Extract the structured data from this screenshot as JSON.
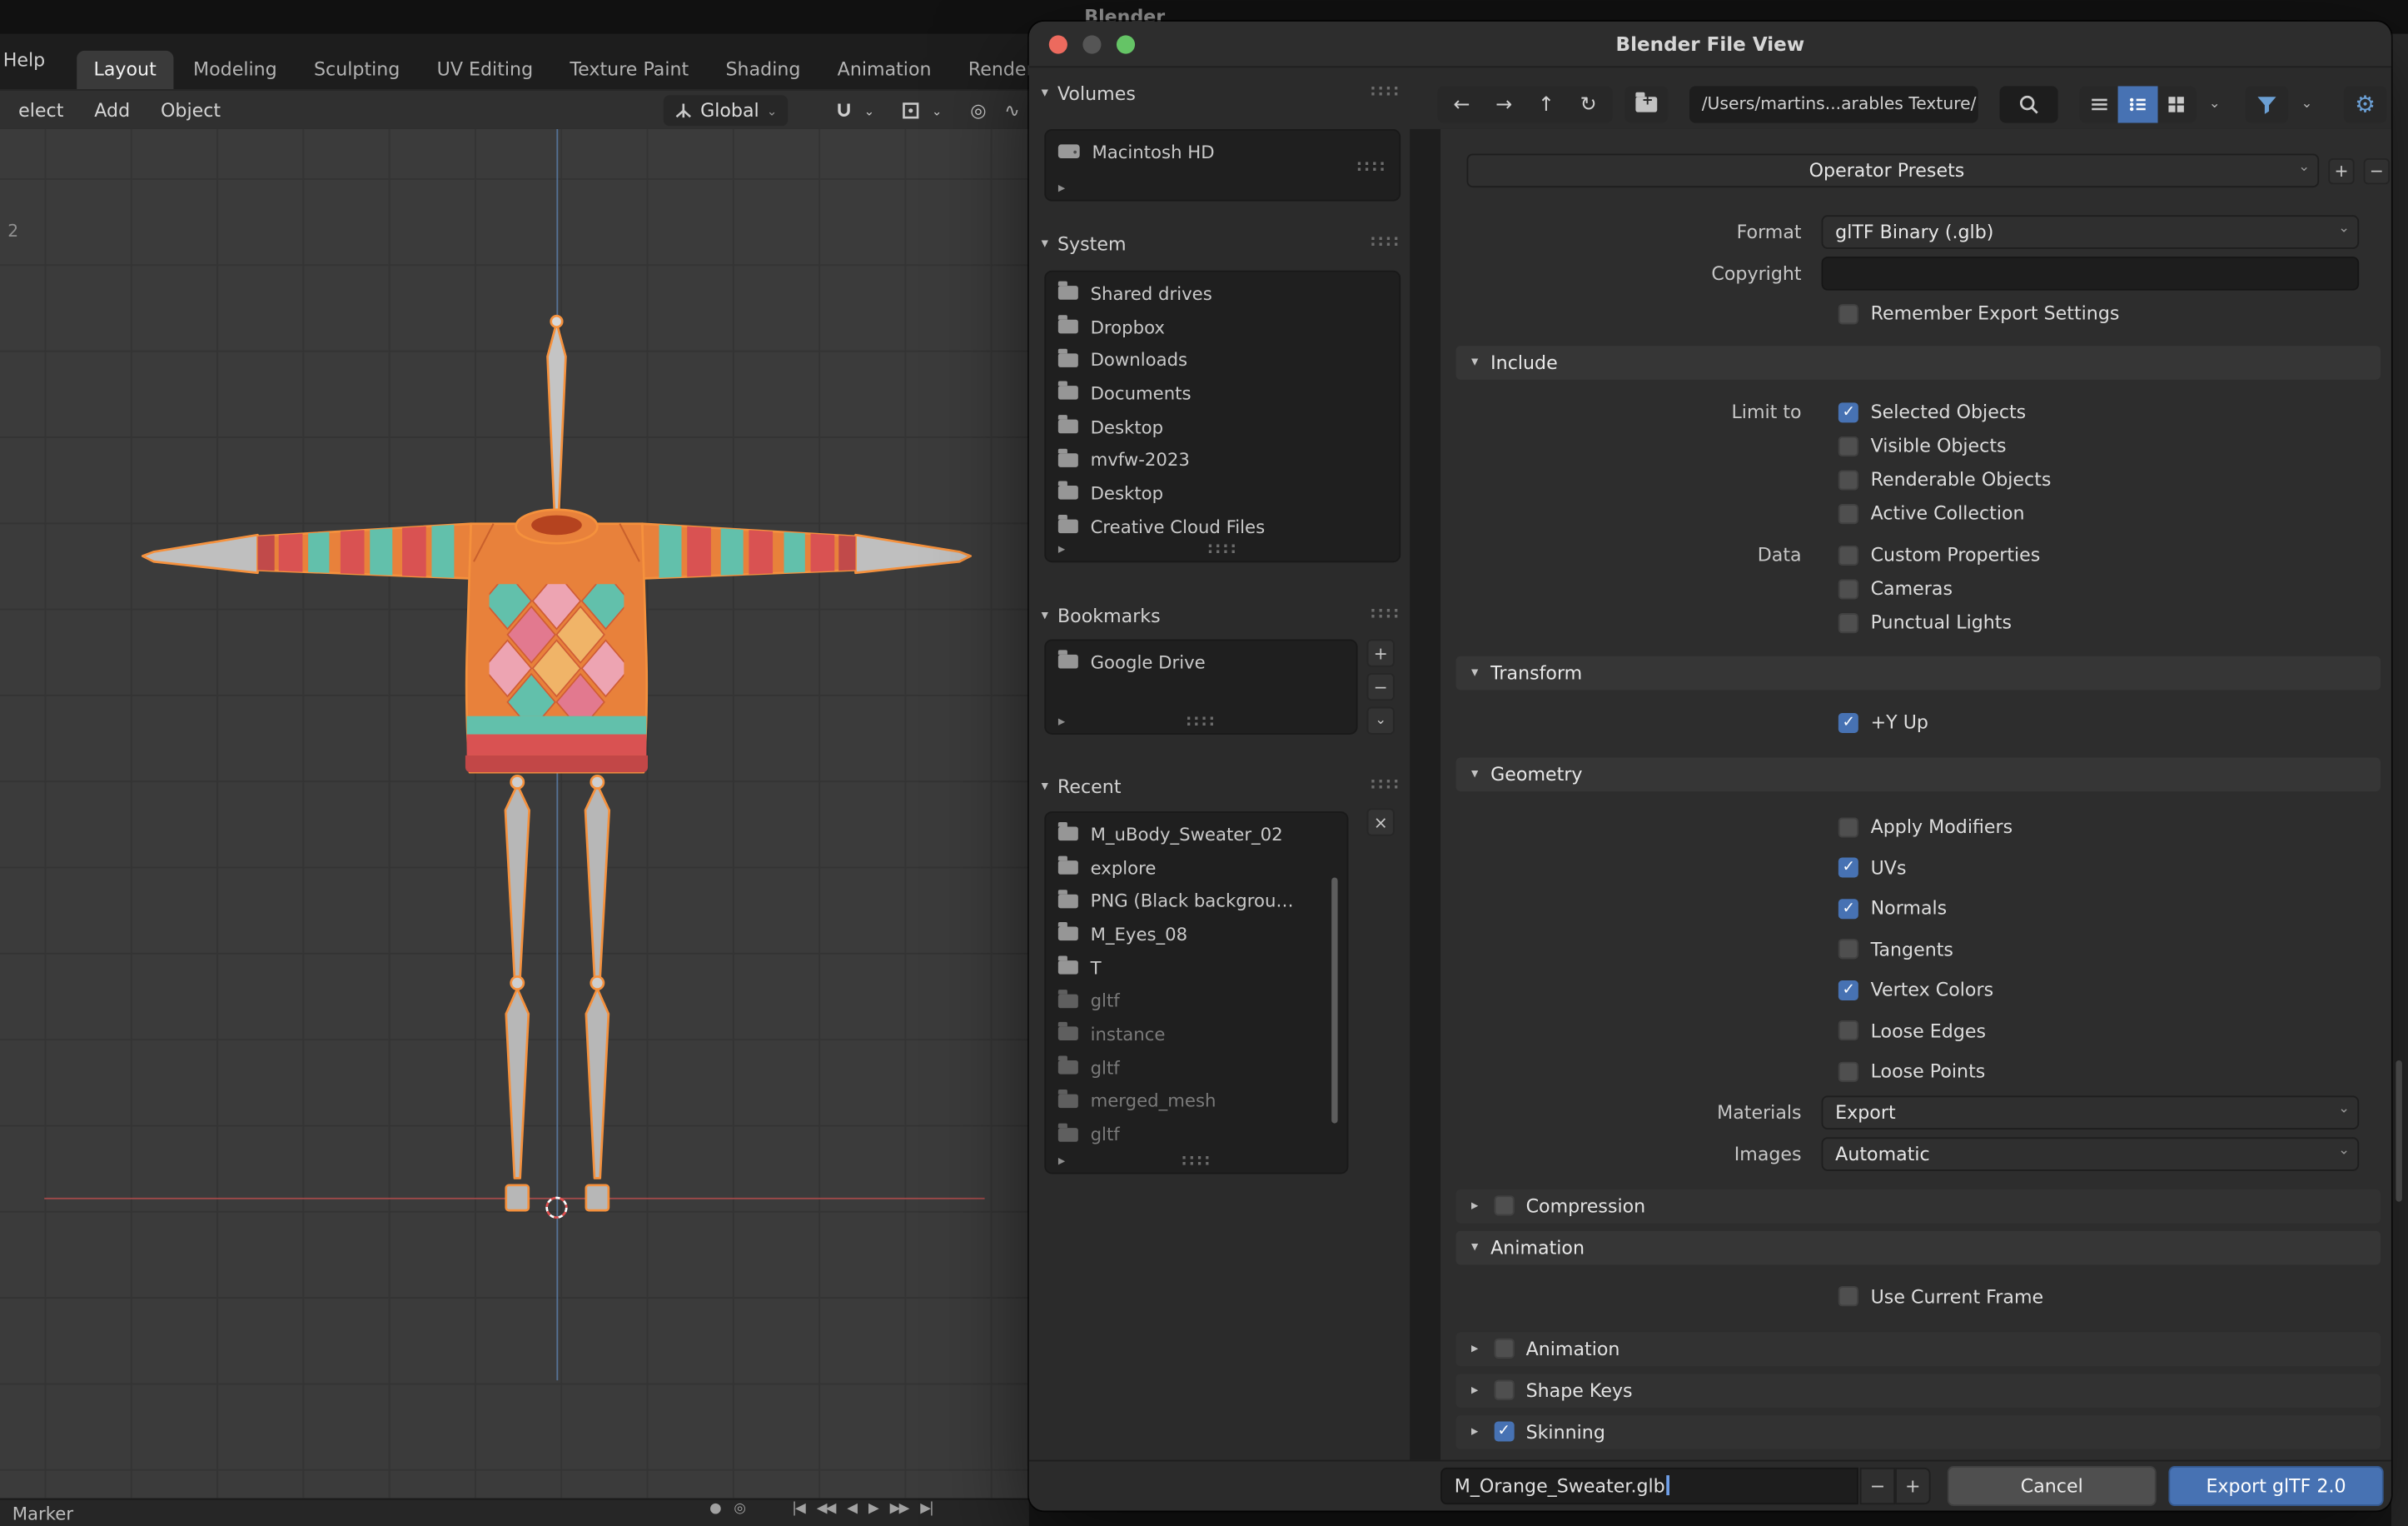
{
  "icons": {
    "chevron_down": "▾",
    "chevron_right": "▸",
    "chevron_small": "⌄",
    "back": "←",
    "forward": "→",
    "up": "↑",
    "refresh": "↻",
    "plus": "+",
    "minus": "−",
    "close": "×",
    "grip": "::::",
    "gear": "⚙",
    "wave": "∿",
    "prop_circle": "◎"
  },
  "background": {
    "screen_title": "Blender",
    "help": "Help",
    "tabs": [
      {
        "label": "Layout",
        "state": "active"
      },
      {
        "label": "Modeling"
      },
      {
        "label": "Sculpting"
      },
      {
        "label": "UV Editing"
      },
      {
        "label": "Texture Paint"
      },
      {
        "label": "Shading"
      },
      {
        "label": "Animation"
      },
      {
        "label": "Rendering"
      }
    ],
    "viewport_menus": [
      "elect",
      "Add",
      "Object"
    ],
    "orientation": "Global",
    "frame_number": "2",
    "marker": "Marker",
    "playback": {
      "record": "●",
      "sphere": "◎",
      "buttons": [
        "|◀",
        "◀◀",
        "◀",
        "▶",
        "▶▶",
        "▶|"
      ]
    }
  },
  "dialog": {
    "title": "Blender File View",
    "toolbar": {
      "path": "/Users/martins...arables Texture/"
    },
    "sidebar": {
      "volumes": {
        "title": "Volumes",
        "items": [
          {
            "label": "Macintosh HD"
          }
        ]
      },
      "system": {
        "title": "System",
        "items": [
          {
            "label": "Shared drives"
          },
          {
            "label": "Dropbox"
          },
          {
            "label": "Downloads"
          },
          {
            "label": "Documents"
          },
          {
            "label": "Desktop"
          },
          {
            "label": "mvfw-2023"
          },
          {
            "label": "Desktop"
          },
          {
            "label": "Creative Cloud Files"
          }
        ]
      },
      "bookmarks": {
        "title": "Bookmarks",
        "items": [
          {
            "label": "Google Drive"
          }
        ]
      },
      "recent": {
        "title": "Recent",
        "items": [
          {
            "label": "M_uBody_Sweater_02"
          },
          {
            "label": "explore"
          },
          {
            "label": "PNG (Black backgrou…"
          },
          {
            "label": "M_Eyes_08"
          },
          {
            "label": "T"
          },
          {
            "label": "gltf",
            "state": "dim"
          },
          {
            "label": "instance",
            "state": "dim"
          },
          {
            "label": "gltf",
            "state": "dim"
          },
          {
            "label": "merged_mesh",
            "state": "dim"
          },
          {
            "label": "gltf",
            "state": "dim"
          }
        ]
      }
    },
    "panel": {
      "presets": "Operator Presets",
      "format": {
        "label": "Format",
        "value": "glTF Binary (.glb)"
      },
      "copyright": {
        "label": "Copyright",
        "value": ""
      },
      "remember": {
        "label": "Remember Export Settings",
        "checked": false
      },
      "include": {
        "title": "Include",
        "limit": [
          {
            "side": "Limit to",
            "label": "Selected Objects",
            "checked": true
          },
          {
            "side": "",
            "label": "Visible Objects",
            "checked": false
          },
          {
            "side": "",
            "label": "Renderable Objects",
            "checked": false
          },
          {
            "side": "",
            "label": "Active Collection",
            "checked": false
          }
        ],
        "data": [
          {
            "side": "Data",
            "label": "Custom Properties",
            "checked": false
          },
          {
            "side": "",
            "label": "Cameras",
            "checked": false
          },
          {
            "side": "",
            "label": "Punctual Lights",
            "checked": false
          }
        ]
      },
      "transform": {
        "title": "Transform",
        "rows": [
          {
            "side": "",
            "label": "+Y Up",
            "checked": true
          }
        ]
      },
      "geometry": {
        "title": "Geometry",
        "rows": [
          {
            "side": "",
            "label": "Apply Modifiers",
            "checked": false
          },
          {
            "side": "",
            "label": "UVs",
            "checked": true
          },
          {
            "side": "",
            "label": "Normals",
            "checked": true
          },
          {
            "side": "",
            "label": "Tangents",
            "checked": false
          },
          {
            "side": "",
            "label": "Vertex Colors",
            "checked": true
          },
          {
            "side": "",
            "label": "Loose Edges",
            "checked": false
          },
          {
            "side": "",
            "label": "Loose Points",
            "checked": false
          }
        ],
        "materials": {
          "label": "Materials",
          "value": "Export"
        },
        "images": {
          "label": "Images",
          "value": "Automatic"
        }
      },
      "compression": {
        "title": "Compression",
        "checked": false
      },
      "animation": {
        "title": "Animation",
        "use_current_frame": {
          "label": "Use Current Frame",
          "checked": false
        },
        "sub_panels": [
          {
            "label": "Animation",
            "checked": false
          },
          {
            "label": "Shape Keys",
            "checked": false
          },
          {
            "label": "Skinning",
            "checked": true
          }
        ]
      }
    },
    "footer": {
      "filename": "M_Orange_Sweater.glb",
      "cancel": "Cancel",
      "export": "Export glTF 2.0"
    }
  }
}
